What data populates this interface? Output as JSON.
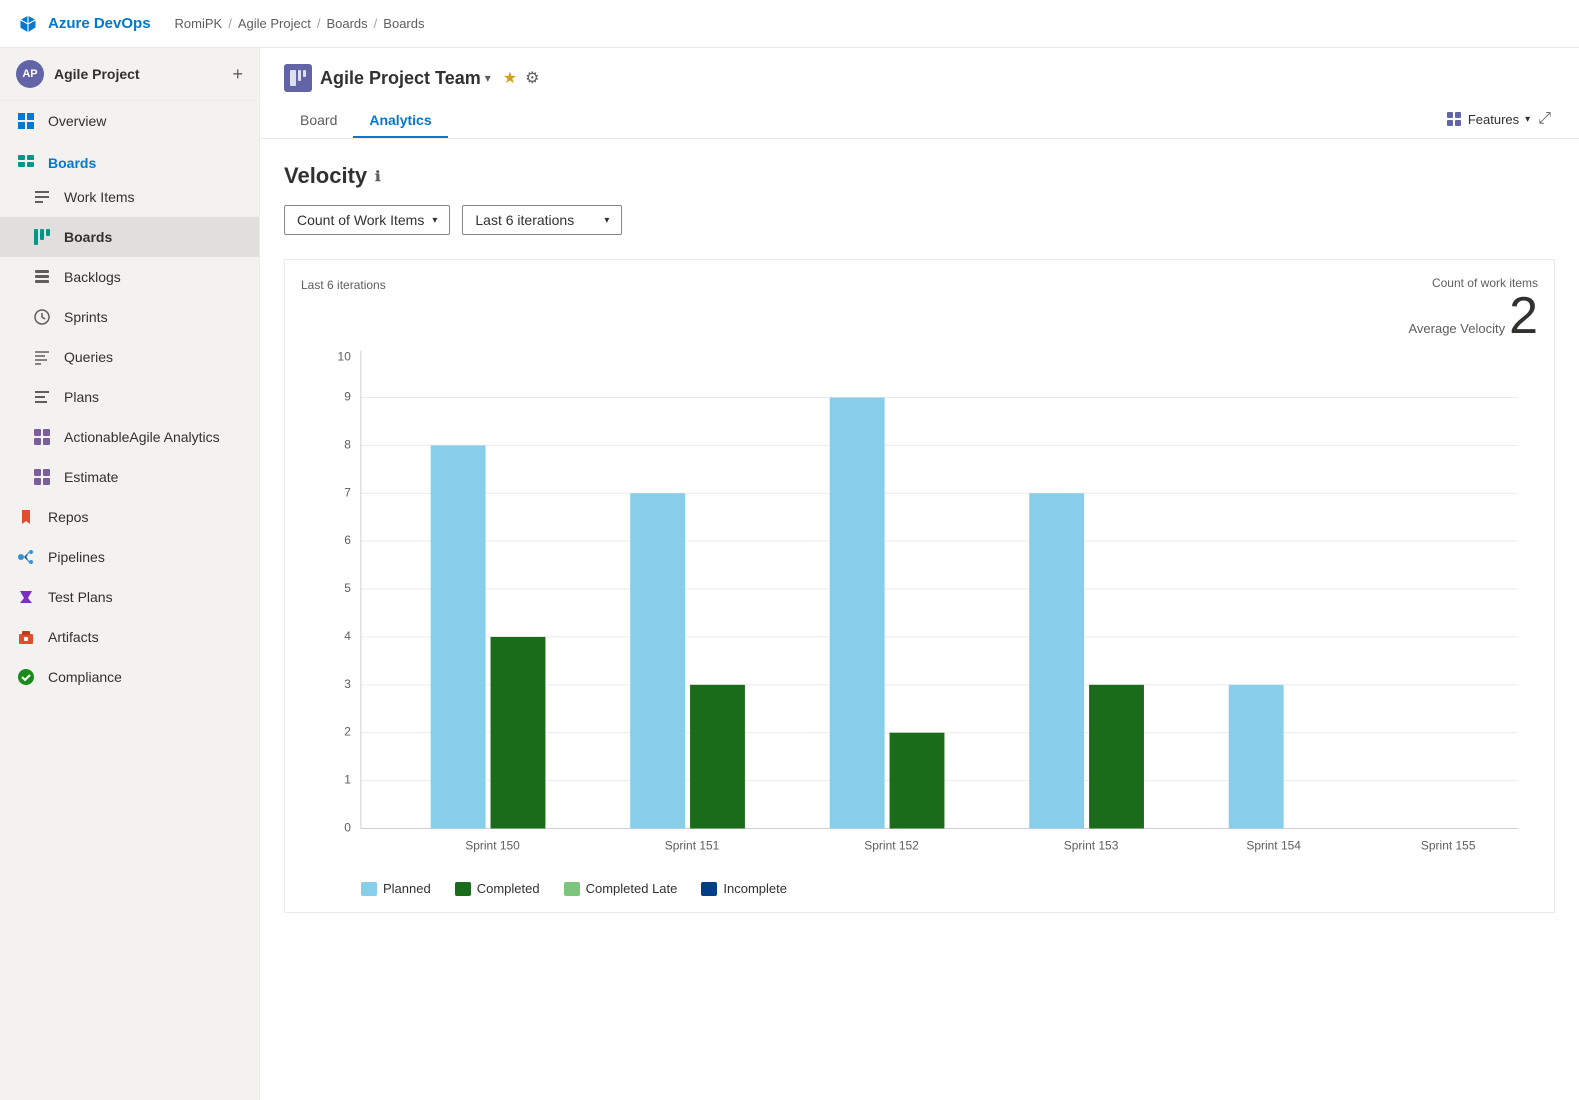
{
  "topbar": {
    "logo_text": "Azure DevOps",
    "breadcrumbs": [
      "RomiPK",
      "Agile Project",
      "Boards",
      "Boards"
    ]
  },
  "sidebar": {
    "project_name": "Agile Project",
    "avatar_initials": "AP",
    "items": [
      {
        "id": "overview",
        "label": "Overview",
        "icon": "overview"
      },
      {
        "id": "boards-section",
        "label": "Boards",
        "icon": "boards",
        "is_section": true
      },
      {
        "id": "work-items",
        "label": "Work Items",
        "icon": "workitems"
      },
      {
        "id": "boards",
        "label": "Boards",
        "icon": "boards",
        "active": true
      },
      {
        "id": "backlogs",
        "label": "Backlogs",
        "icon": "backlogs"
      },
      {
        "id": "sprints",
        "label": "Sprints",
        "icon": "sprints"
      },
      {
        "id": "queries",
        "label": "Queries",
        "icon": "queries"
      },
      {
        "id": "plans",
        "label": "Plans",
        "icon": "plans"
      },
      {
        "id": "actionable-agile",
        "label": "ActionableAgile Analytics",
        "icon": "analytics"
      },
      {
        "id": "estimate",
        "label": "Estimate",
        "icon": "estimate"
      },
      {
        "id": "repos",
        "label": "Repos",
        "icon": "repos"
      },
      {
        "id": "pipelines",
        "label": "Pipelines",
        "icon": "pipelines"
      },
      {
        "id": "test-plans",
        "label": "Test Plans",
        "icon": "testplans"
      },
      {
        "id": "artifacts",
        "label": "Artifacts",
        "icon": "artifacts"
      },
      {
        "id": "compliance",
        "label": "Compliance",
        "icon": "compliance"
      }
    ]
  },
  "header": {
    "team_name": "Agile Project Team",
    "tabs": [
      {
        "id": "board",
        "label": "Board",
        "active": false
      },
      {
        "id": "analytics",
        "label": "Analytics",
        "active": true
      }
    ],
    "features_label": "Features"
  },
  "velocity": {
    "title": "Velocity",
    "filter_metric": "Count of Work Items",
    "filter_iterations": "Last 6 iterations",
    "chart_label_left": "Last 6 iterations",
    "chart_metric_name": "Count of work items",
    "chart_metric_sub": "Average Velocity",
    "chart_metric_value": "2",
    "y_labels": [
      "0",
      "1",
      "2",
      "3",
      "4",
      "5",
      "6",
      "7",
      "8",
      "9",
      "10"
    ],
    "sprints": [
      {
        "label": "Sprint 150",
        "planned": 8,
        "completed": 4,
        "completed_late": 0,
        "incomplete": 0
      },
      {
        "label": "Sprint 151",
        "planned": 7,
        "completed": 3,
        "completed_late": 0,
        "incomplete": 0
      },
      {
        "label": "Sprint 152",
        "planned": 9,
        "completed": 2,
        "completed_late": 0,
        "incomplete": 0
      },
      {
        "label": "Sprint 153",
        "planned": 7,
        "completed": 3,
        "completed_late": 0,
        "incomplete": 0
      },
      {
        "label": "Sprint 154",
        "planned": 3,
        "completed": 0,
        "completed_late": 0,
        "incomplete": 0
      },
      {
        "label": "Sprint 155",
        "planned": 0,
        "completed": 0,
        "completed_late": 0,
        "incomplete": 0
      }
    ],
    "legend": [
      {
        "id": "planned",
        "label": "Planned",
        "color": "#87ceeb"
      },
      {
        "id": "completed",
        "label": "Completed",
        "color": "#1a6b1a"
      },
      {
        "id": "completed-late",
        "label": "Completed Late",
        "color": "#7dc47d"
      },
      {
        "id": "incomplete",
        "label": "Incomplete",
        "color": "#003f87"
      }
    ]
  }
}
